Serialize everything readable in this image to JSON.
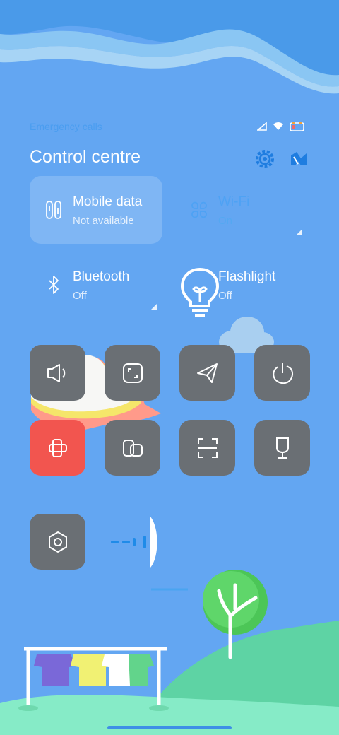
{
  "status_bar": {
    "emergency_text": "Emergency calls",
    "icons": [
      "signal-icon",
      "wifi-icon",
      "battery-icon"
    ]
  },
  "header": {
    "title": "Control centre",
    "icons": [
      "settings-icon",
      "edit-icon"
    ]
  },
  "big_tiles": [
    {
      "name": "mobile-data",
      "label": "Mobile data",
      "status": "Not available",
      "icon": "mobile-data-icon"
    },
    {
      "name": "wifi",
      "label": "Wi-Fi",
      "status": "On",
      "icon": "wifi-tile-icon"
    },
    {
      "name": "bluetooth",
      "label": "Bluetooth",
      "status": "Off",
      "icon": "bluetooth-icon"
    },
    {
      "name": "flashlight",
      "label": "Flashlight",
      "status": "Off",
      "icon": "flashlight-icon"
    }
  ],
  "toggles": [
    {
      "name": "sound",
      "icon": "speaker-icon"
    },
    {
      "name": "screenshot",
      "icon": "screenshot-icon"
    },
    {
      "name": "airplane-mode",
      "icon": "paper-plane-icon"
    },
    {
      "name": "power",
      "icon": "power-icon"
    },
    {
      "name": "rotation-lock",
      "icon": "rotation-lock-icon"
    },
    {
      "name": "floating-window",
      "icon": "floating-window-icon"
    },
    {
      "name": "scanner",
      "icon": "scan-icon"
    },
    {
      "name": "lamp",
      "icon": "lamp-icon"
    },
    {
      "name": "settings-shortcut",
      "icon": "hexagon-nut-icon"
    }
  ],
  "colors": {
    "background": "#63a6f2",
    "toggle_bg": "#6a6f74",
    "toggle_active": "#f2554f",
    "hill_green": "#5fd6a8",
    "tree_green": "#4cc657"
  }
}
